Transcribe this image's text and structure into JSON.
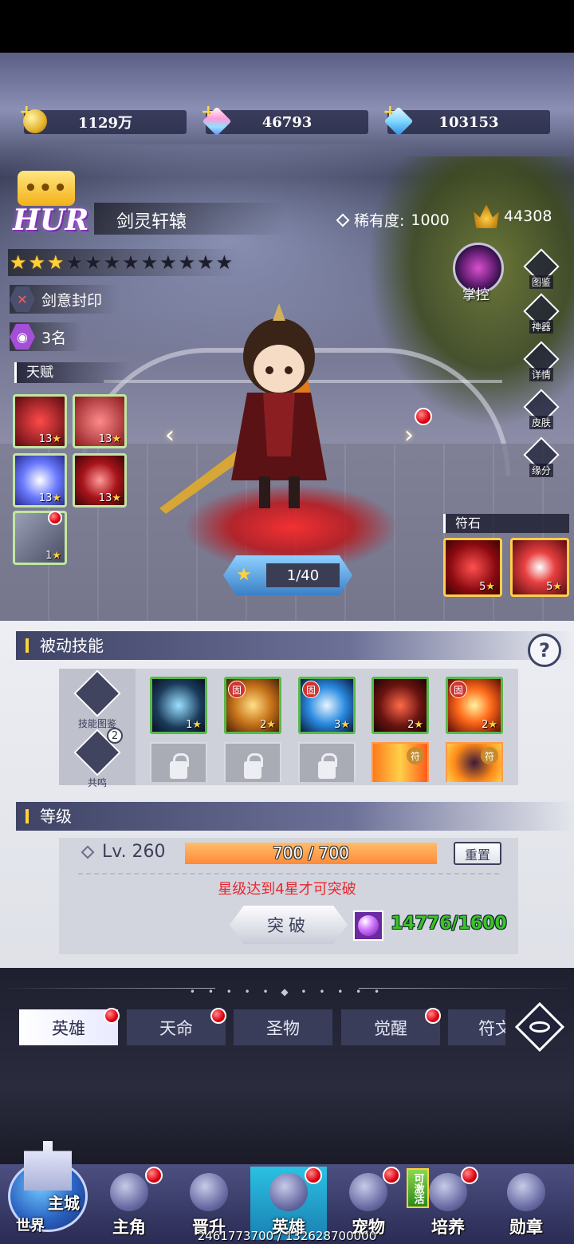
{
  "resources": {
    "gold": "1129万",
    "crystal": "46793",
    "diamond": "103153"
  },
  "hero": {
    "grade_icon": "•••",
    "grade": "HUR",
    "name": "剑灵轩辕",
    "rarity_label": "稀有度:",
    "rarity_value": "1000",
    "power": "44308",
    "stars_filled": 3,
    "stars_total": 12,
    "seal": "剑意封印",
    "rank": "3名",
    "level_progress": "1/40"
  },
  "talent": {
    "title": "天赋",
    "skills": [
      {
        "level": "13",
        "icon": "red-slash-icon"
      },
      {
        "level": "13",
        "icon": "red-fist-icon"
      },
      {
        "level": "13",
        "icon": "blue-wave-icon"
      },
      {
        "level": "13",
        "icon": "red-sword-icon"
      },
      {
        "level": "1",
        "icon": "silver-blade-icon"
      }
    ]
  },
  "side_buttons": {
    "control": "掌控",
    "catalog": "图鉴",
    "artifact": "神器",
    "details": "详情",
    "skin": "皮肤",
    "fate": "缘分"
  },
  "runes": {
    "title": "符石",
    "items": [
      {
        "level": "5"
      },
      {
        "level": "5"
      }
    ]
  },
  "passive": {
    "title": "被动技能",
    "catalog": "技能图鉴",
    "resonance": "共鸣",
    "resonance_badge": "2",
    "skills": [
      {
        "level": "1",
        "tag": ""
      },
      {
        "level": "2",
        "tag": "固"
      },
      {
        "level": "3",
        "tag": "固"
      },
      {
        "level": "2",
        "tag": ""
      },
      {
        "level": "2",
        "tag": "固"
      }
    ],
    "second_row_tags": [
      "符",
      "符"
    ]
  },
  "level": {
    "title": "等级",
    "lv_text": "Lv. 260",
    "exp": "700 / 700",
    "exp_fraction": 1.0,
    "reset": "重置",
    "warning": "星级达到4星才可突破",
    "break_label": "突破",
    "material": "14776/1600"
  },
  "tabs": {
    "ornament": "• • • • • ◆ • • • • •",
    "items": [
      {
        "label": "英雄",
        "active": true
      },
      {
        "label": "天命",
        "active": false
      },
      {
        "label": "圣物",
        "active": false
      },
      {
        "label": "觉醒",
        "active": false
      },
      {
        "label": "符文",
        "active": false
      }
    ]
  },
  "nav": {
    "main_city": "主城",
    "world": "世界",
    "protagonist": "主角",
    "promote": "晋升",
    "hero": "英雄",
    "pet": "宠物",
    "cultivate": "培养",
    "medal": "勋章",
    "activatable": "可激活"
  },
  "footer": "2461773700 / 132628700000",
  "colors": {
    "star_on": "#ffd23a",
    "exp_bar": "#ff8a3a",
    "warning": "#e8262e",
    "material_count": "#39c424",
    "nav_active": "#2bc1e3"
  }
}
